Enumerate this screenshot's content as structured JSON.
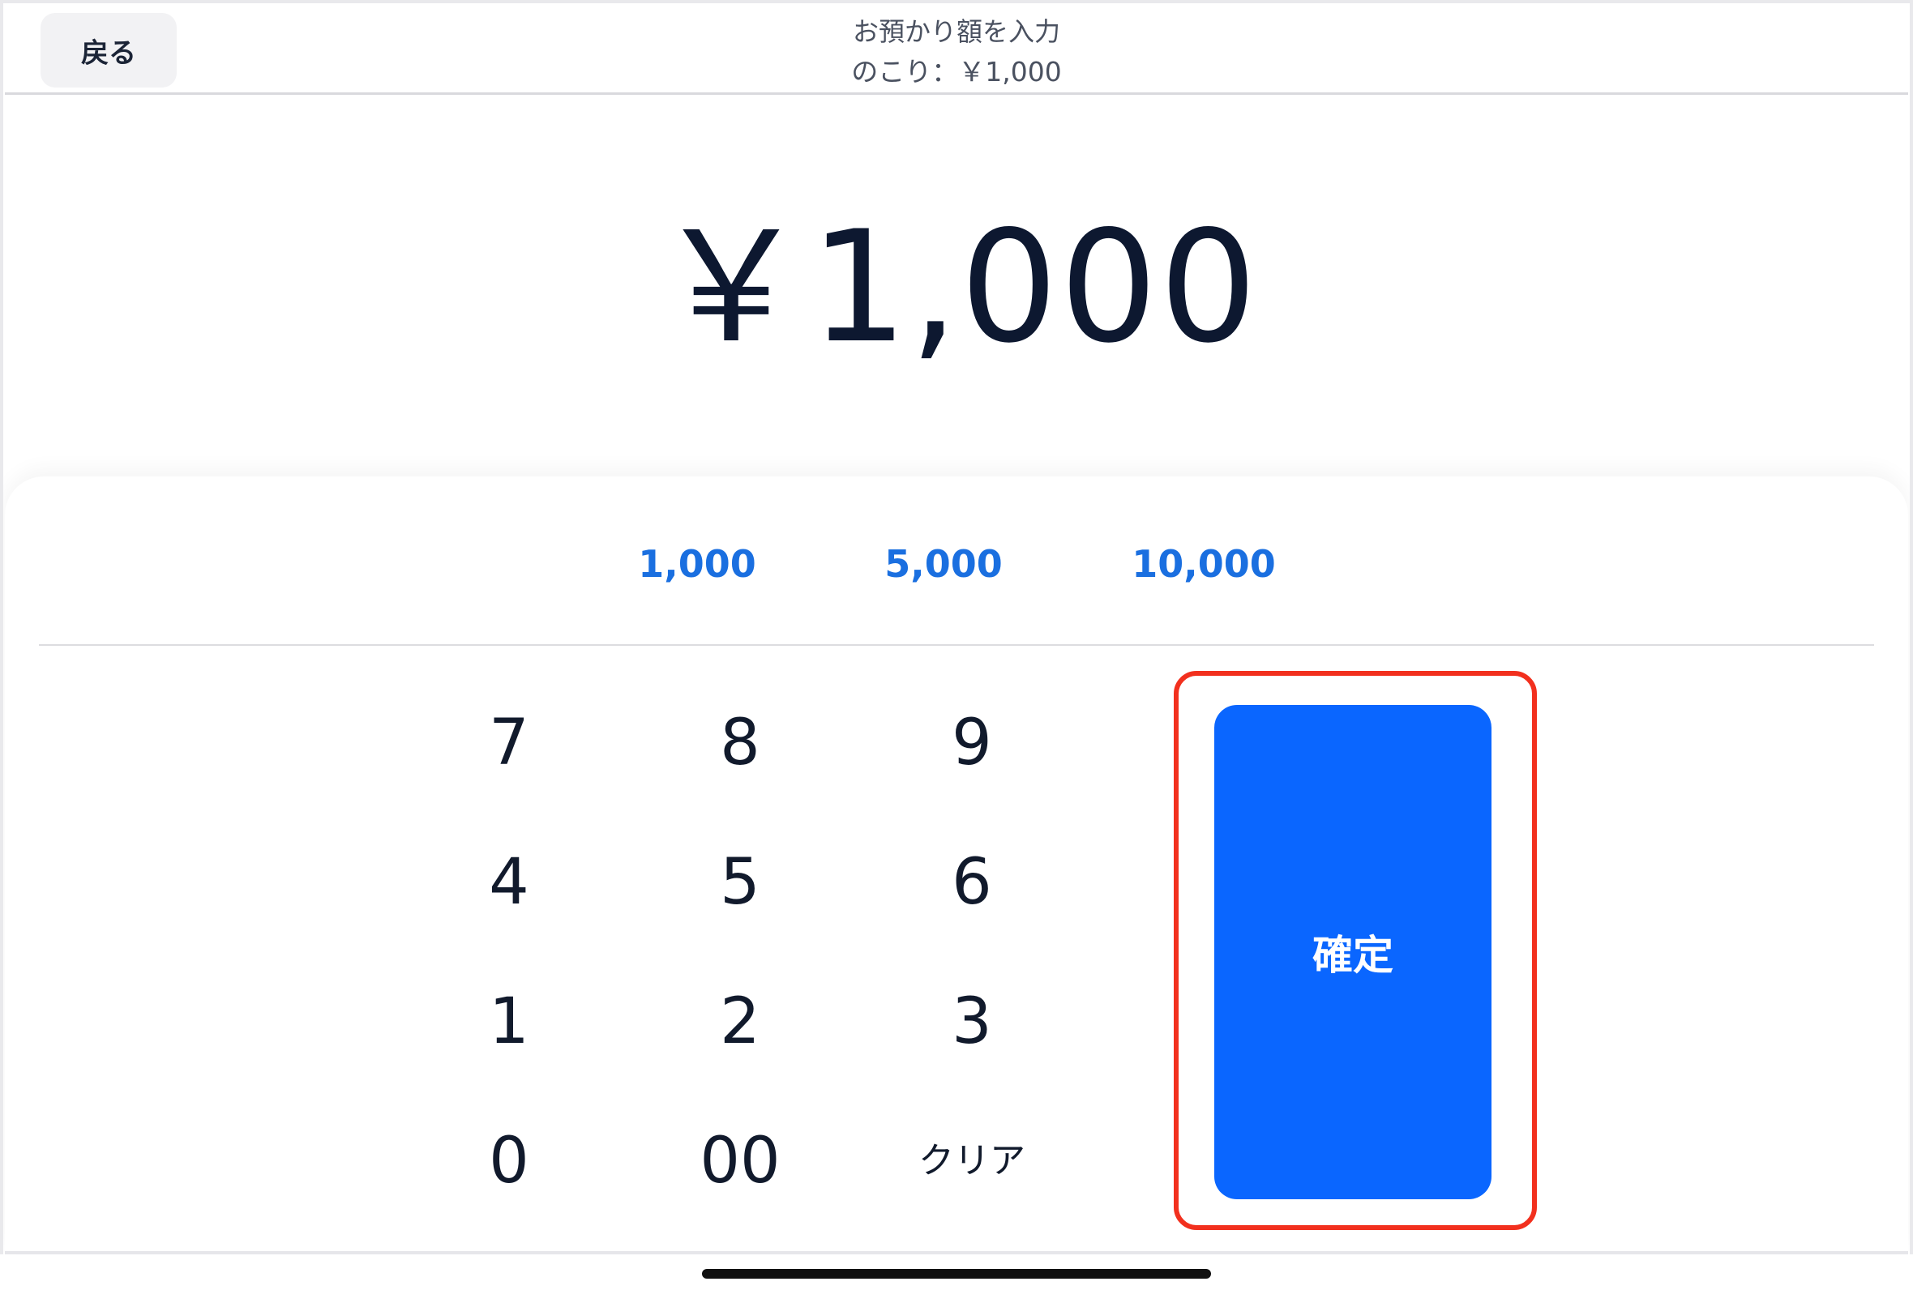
{
  "header": {
    "back_label": "戻る",
    "title": "お預かり額を入力",
    "remaining": "のこり：￥1,000"
  },
  "amount": {
    "display": "￥1,000"
  },
  "quick_amounts": [
    "1,000",
    "5,000",
    "10,000"
  ],
  "keypad": {
    "keys": [
      "7",
      "8",
      "9",
      "4",
      "5",
      "6",
      "1",
      "2",
      "3",
      "0",
      "00",
      "クリア"
    ]
  },
  "confirm": {
    "label": "確定"
  },
  "colors": {
    "accent": "#0a66ff",
    "quick_text": "#1a6fe0",
    "highlight_border": "#f2301e",
    "text": "#0f1a2e"
  }
}
